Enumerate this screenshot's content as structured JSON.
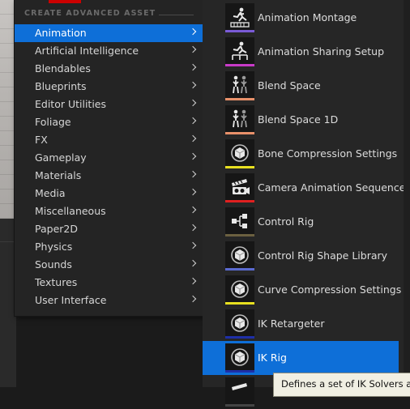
{
  "left_menu": {
    "section_header": "CREATE ADVANCED ASSET",
    "items": [
      {
        "label": "Animation",
        "selected": true
      },
      {
        "label": "Artificial Intelligence"
      },
      {
        "label": "Blendables"
      },
      {
        "label": "Blueprints"
      },
      {
        "label": "Editor Utilities"
      },
      {
        "label": "Foliage"
      },
      {
        "label": "FX"
      },
      {
        "label": "Gameplay"
      },
      {
        "label": "Materials"
      },
      {
        "label": "Media"
      },
      {
        "label": "Miscellaneous"
      },
      {
        "label": "Paper2D"
      },
      {
        "label": "Physics"
      },
      {
        "label": "Sounds"
      },
      {
        "label": "Textures"
      },
      {
        "label": "User Interface"
      }
    ]
  },
  "submenu": {
    "items": [
      {
        "label": "Animation Montage",
        "icon": "montage-icon",
        "bar_color": "#7a5bd6"
      },
      {
        "label": "Animation Sharing Setup",
        "icon": "sharing-setup-icon",
        "bar_color": "#c83bc8"
      },
      {
        "label": "Blend Space",
        "icon": "blend-space-icon",
        "bar_color": "#e8906a"
      },
      {
        "label": "Blend Space 1D",
        "icon": "blend-space-1d-icon",
        "bar_color": "#e8906a"
      },
      {
        "label": "Bone Compression Settings",
        "icon": "cube-icon",
        "bar_color": "#e8e020"
      },
      {
        "label": "Camera Animation Sequence",
        "icon": "camera-clapper-icon",
        "bar_color": "#e02020"
      },
      {
        "label": "Control Rig",
        "icon": "control-rig-icon",
        "bar_color": "#6b6040"
      },
      {
        "label": "Control Rig Shape Library",
        "icon": "cube-icon",
        "bar_color": "#5a6ad0"
      },
      {
        "label": "Curve Compression Settings",
        "icon": "cube-icon",
        "bar_color": "#e8e020"
      },
      {
        "label": "IK Retargeter",
        "icon": "cube-icon",
        "bar_color": "#1e2fa8"
      },
      {
        "label": "IK Rig",
        "icon": "cube-icon",
        "bar_color": "#1e2fa8",
        "selected": true
      },
      {
        "label": "",
        "icon": "clapper-icon",
        "bar_color": "#444444"
      }
    ]
  },
  "tooltip": {
    "text": "Defines a set of IK Solvers and"
  }
}
